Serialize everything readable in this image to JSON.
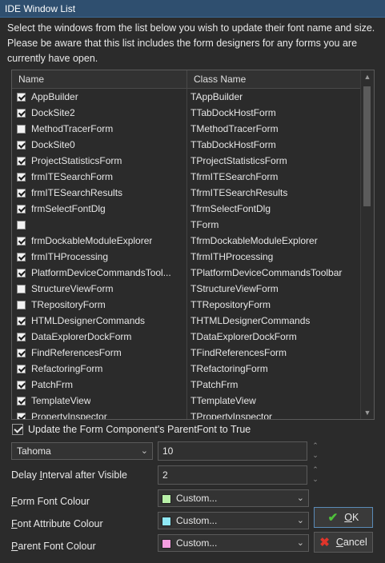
{
  "window": {
    "title": "IDE Window List"
  },
  "description": "Select the windows from the list below you wish to update their font name and size. Please be aware that this list includes the form designers for any forms you are currently have open.",
  "list": {
    "columns": [
      "Name",
      "Class Name"
    ],
    "rows": [
      {
        "name": "AppBuilder",
        "cls": "TAppBuilder",
        "checked": true
      },
      {
        "name": "DockSite2",
        "cls": "TTabDockHostForm",
        "checked": true
      },
      {
        "name": "MethodTracerForm",
        "cls": "TMethodTracerForm",
        "checked": false
      },
      {
        "name": "DockSite0",
        "cls": "TTabDockHostForm",
        "checked": true
      },
      {
        "name": "ProjectStatisticsForm",
        "cls": "TProjectStatisticsForm",
        "checked": true
      },
      {
        "name": "frmITESearchForm",
        "cls": "TfrmITESearchForm",
        "checked": true
      },
      {
        "name": "frmITESearchResults",
        "cls": "TfrmITESearchResults",
        "checked": true
      },
      {
        "name": "frmSelectFontDlg",
        "cls": "TfrmSelectFontDlg",
        "checked": true
      },
      {
        "name": "",
        "cls": "TForm",
        "checked": false
      },
      {
        "name": "frmDockableModuleExplorer",
        "cls": "TfrmDockableModuleExplorer",
        "checked": true
      },
      {
        "name": "frmITHProcessing",
        "cls": "TfrmITHProcessing",
        "checked": true
      },
      {
        "name": "PlatformDeviceCommandsTool...",
        "cls": "TPlatformDeviceCommandsToolbar",
        "checked": true
      },
      {
        "name": "StructureViewForm",
        "cls": "TStructureViewForm",
        "checked": false
      },
      {
        "name": "TRepositoryForm",
        "cls": "TTRepositoryForm",
        "checked": false
      },
      {
        "name": "HTMLDesignerCommands",
        "cls": "THTMLDesignerCommands",
        "checked": true
      },
      {
        "name": "DataExplorerDockForm",
        "cls": "TDataExplorerDockForm",
        "checked": true
      },
      {
        "name": "FindReferencesForm",
        "cls": "TFindReferencesForm",
        "checked": true
      },
      {
        "name": "RefactoringForm",
        "cls": "TRefactoringForm",
        "checked": true
      },
      {
        "name": "PatchFrm",
        "cls": "TPatchFrm",
        "checked": true
      },
      {
        "name": "TemplateView",
        "cls": "TTemplateView",
        "checked": true
      },
      {
        "name": "PropertyInspector",
        "cls": "TPropertyInspector",
        "checked": true
      }
    ]
  },
  "update_parentfont": {
    "label": "Update the Form Component's ParentFont to True",
    "checked": true
  },
  "font": {
    "name": "Tahoma",
    "size": "10"
  },
  "delay": {
    "label_pre": "Delay ",
    "label_u": "I",
    "label_post": "nterval after Visible",
    "value": "2"
  },
  "colours": [
    {
      "label_u": "F",
      "label_rest": "orm Font Colour",
      "value": "Custom...",
      "swatch": "#b8f0a8"
    },
    {
      "label_u": "F",
      "label_rest": "ont Attribute Colour",
      "value": "Custom...",
      "swatch": "#8fe8f5"
    },
    {
      "label_u": "P",
      "label_rest": "arent Font Colour",
      "value": "Custom...",
      "swatch": "#f59ee0"
    }
  ],
  "buttons": {
    "ok": {
      "label_u": "O",
      "label_rest": "K"
    },
    "cancel": {
      "label_u": "C",
      "label_rest": "ancel"
    }
  },
  "icons": [
    "check-icon",
    "cross-icon",
    "chevron-down-icon",
    "spin-up-icon",
    "spin-down-icon"
  ]
}
